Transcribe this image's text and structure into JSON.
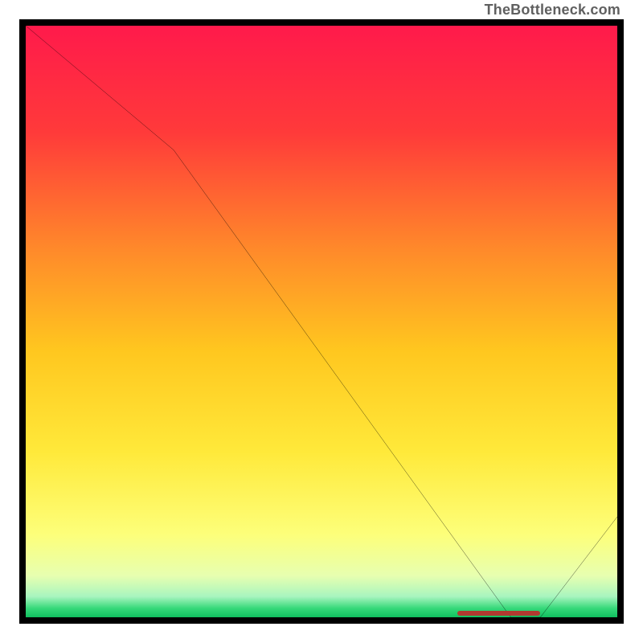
{
  "attribution": "TheBottleneck.com",
  "chart_data": {
    "type": "line",
    "title": "",
    "xlabel": "",
    "ylabel": "",
    "xlim": [
      0,
      100
    ],
    "ylim": [
      0,
      100
    ],
    "grid": false,
    "legend": false,
    "series": [
      {
        "name": "curve",
        "x": [
          0,
          25,
          82,
          87,
          100
        ],
        "y": [
          100,
          79,
          0,
          0,
          17
        ]
      }
    ],
    "marker_band": {
      "x_start": 73,
      "x_end": 87,
      "y": 0
    },
    "gradient_stops": [
      {
        "offset": 0.0,
        "color": "#ff1a4b"
      },
      {
        "offset": 0.18,
        "color": "#ff3a3a"
      },
      {
        "offset": 0.38,
        "color": "#ff8a2a"
      },
      {
        "offset": 0.55,
        "color": "#ffc71f"
      },
      {
        "offset": 0.72,
        "color": "#ffe93a"
      },
      {
        "offset": 0.86,
        "color": "#fdff7a"
      },
      {
        "offset": 0.93,
        "color": "#e7ffb0"
      },
      {
        "offset": 0.965,
        "color": "#a8f5bf"
      },
      {
        "offset": 0.985,
        "color": "#35d879"
      },
      {
        "offset": 1.0,
        "color": "#10bf5f"
      }
    ]
  }
}
